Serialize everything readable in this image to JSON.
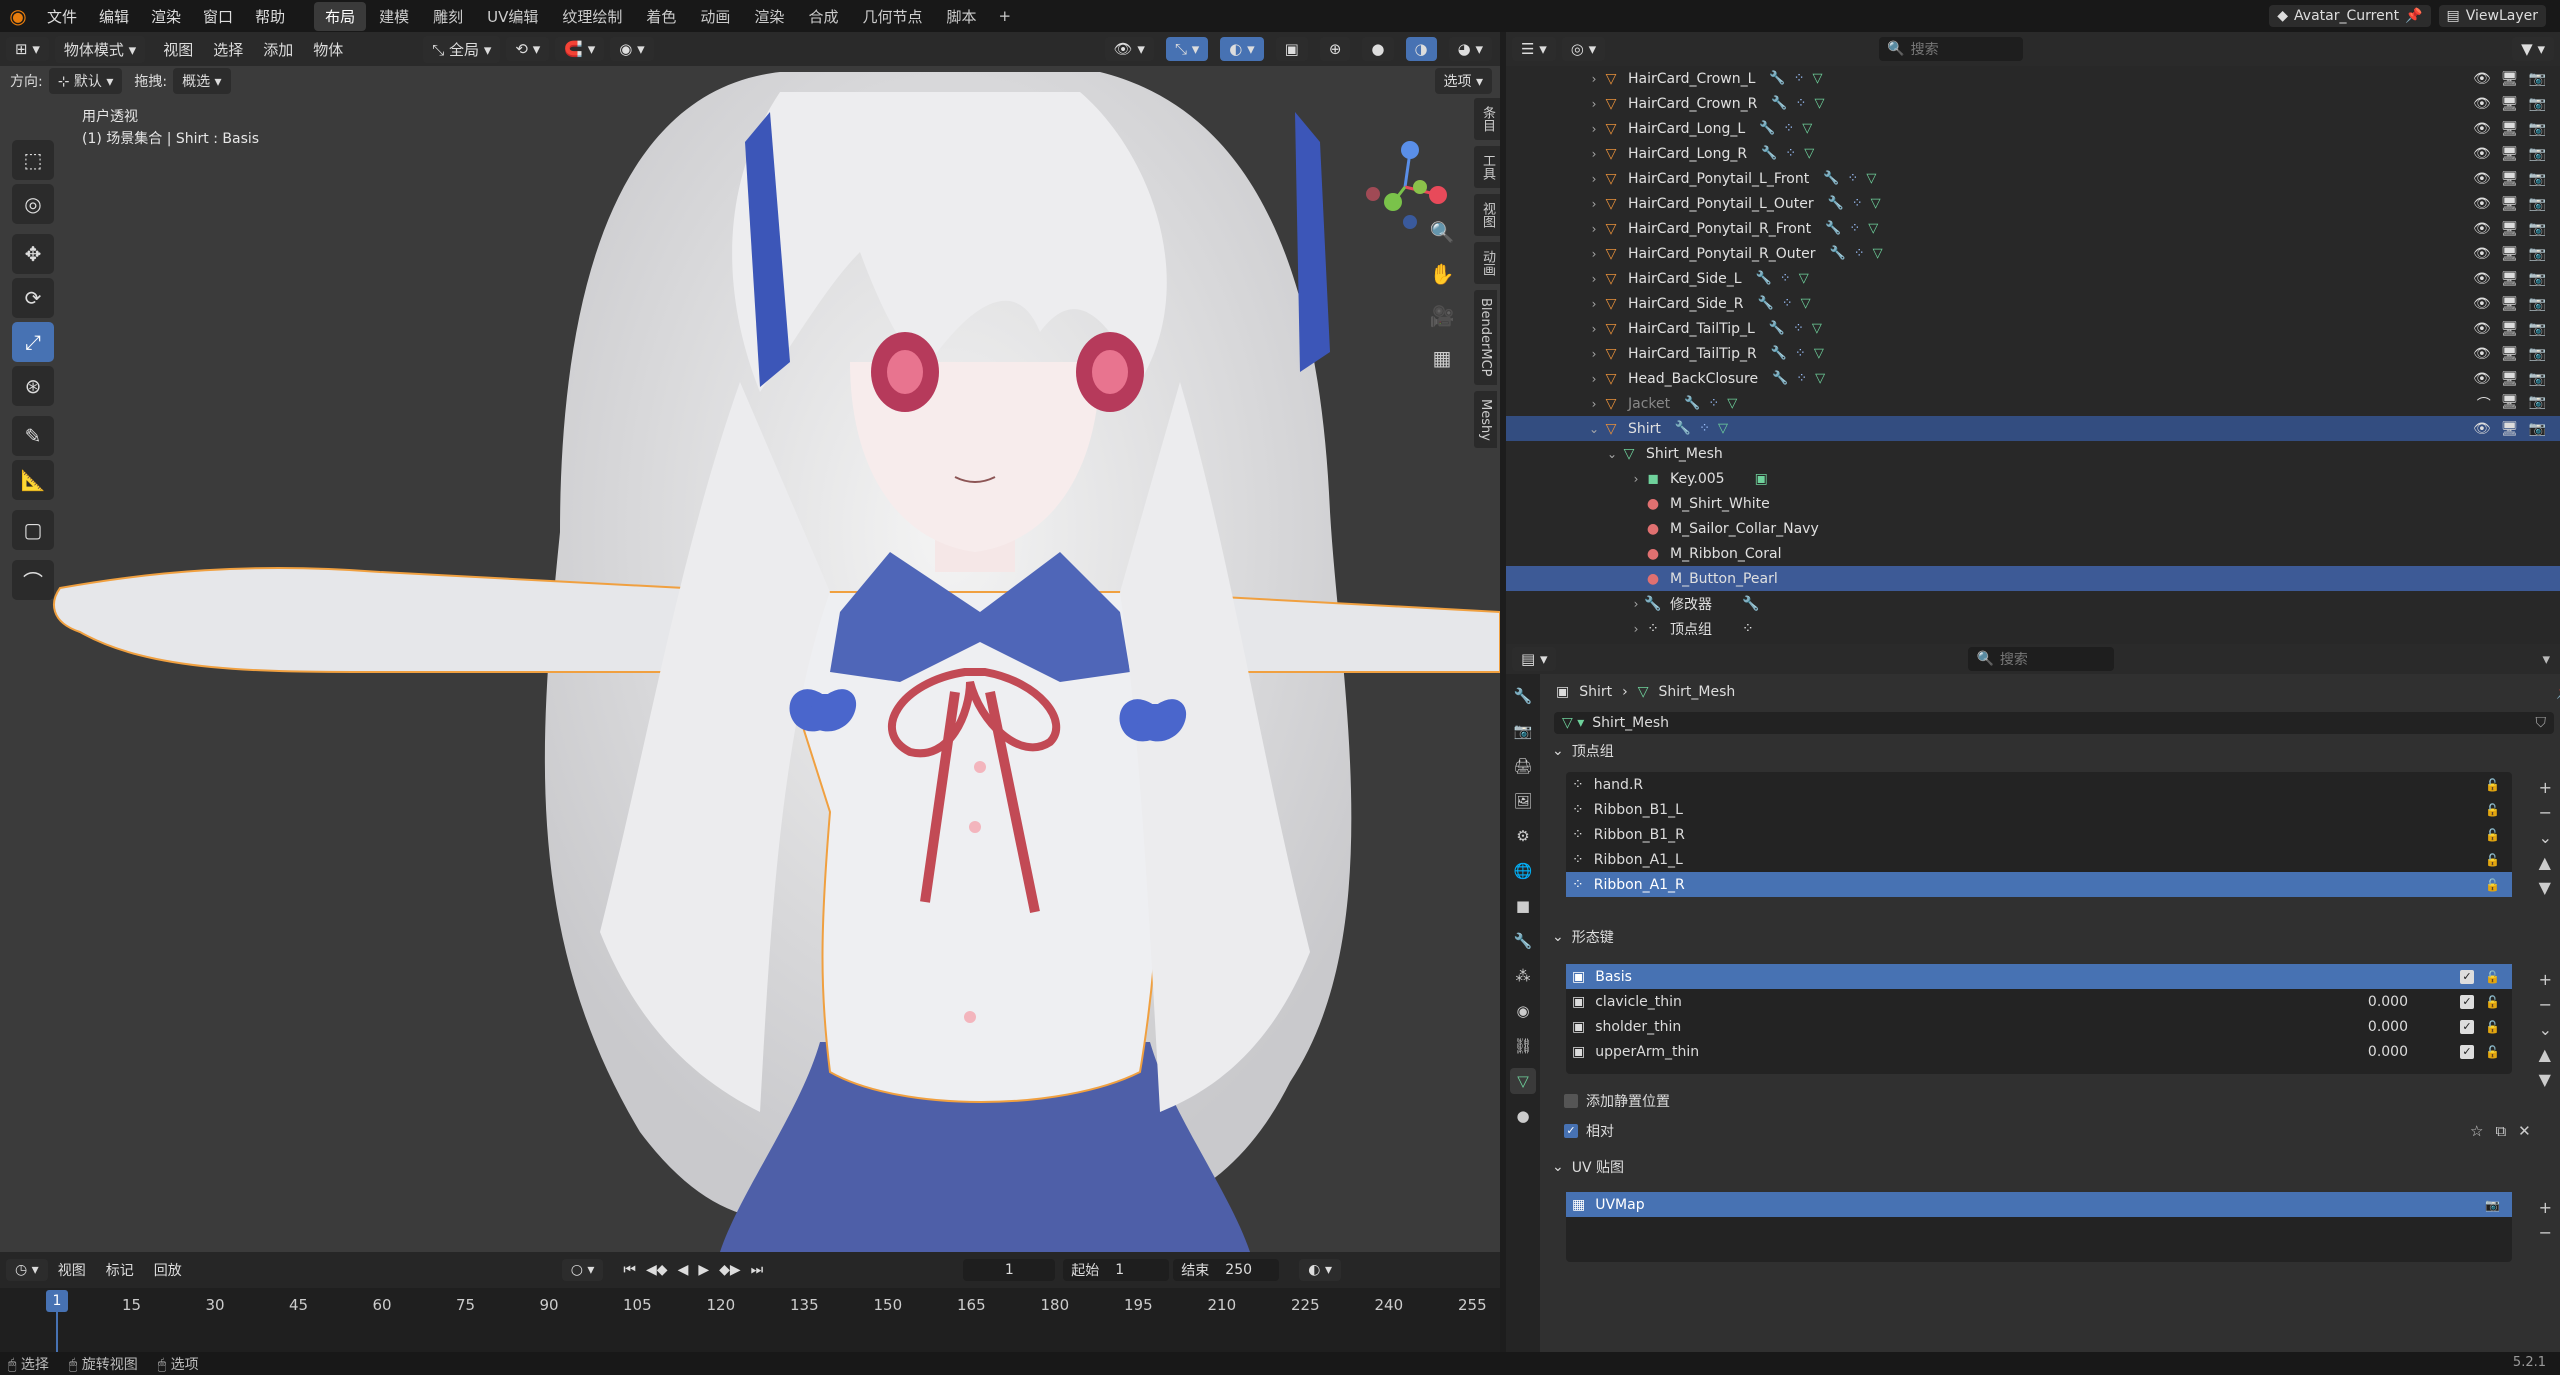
{
  "topbar": {
    "menus": [
      "文件",
      "编辑",
      "渲染",
      "窗口",
      "帮助"
    ],
    "workspaces": [
      "布局",
      "建模",
      "雕刻",
      "UV编辑",
      "纹理绘制",
      "着色",
      "动画",
      "渲染",
      "合成",
      "几何节点",
      "脚本"
    ],
    "active_workspace": "布局",
    "scene": "Avatar_Current",
    "view_layer": "ViewLayer"
  },
  "viewport": {
    "mode": "物体模式",
    "menus": [
      "视图",
      "选择",
      "添加",
      "物体"
    ],
    "orientation_label": "方向:",
    "orientation_value": "默认",
    "drag_label": "拖拽:",
    "drag_value": "概选",
    "transform_global": "全局",
    "options": "选项",
    "info_line1": "用户透视",
    "info_line2": "(1) 场景集合 | Shirt : Basis",
    "side_tabs": [
      "条目",
      "工具",
      "视图",
      "动画",
      "BlenderMCP",
      "Meshy"
    ]
  },
  "timeline": {
    "menus": [
      "视图",
      "标记",
      "回放"
    ],
    "current_frame": "1",
    "start_label": "起始",
    "start": "1",
    "end_label": "结束",
    "end": "250",
    "ticks": [
      "1",
      "15",
      "30",
      "45",
      "60",
      "75",
      "90",
      "105",
      "120",
      "135",
      "150",
      "165",
      "180",
      "195",
      "210",
      "225",
      "240",
      "255"
    ]
  },
  "status": {
    "items": [
      "选择",
      "旋转视图",
      "选项"
    ],
    "version": "5.2.1"
  },
  "outliner": {
    "search_placeholder": "搜索",
    "rows": [
      {
        "label": "HairCard_Crown_L",
        "type": "object"
      },
      {
        "label": "HairCard_Crown_R",
        "type": "object"
      },
      {
        "label": "HairCard_Long_L",
        "type": "object"
      },
      {
        "label": "HairCard_Long_R",
        "type": "object"
      },
      {
        "label": "HairCard_Ponytail_L_Front",
        "type": "object"
      },
      {
        "label": "HairCard_Ponytail_L_Outer",
        "type": "object"
      },
      {
        "label": "HairCard_Ponytail_R_Front",
        "type": "object"
      },
      {
        "label": "HairCard_Ponytail_R_Outer",
        "type": "object"
      },
      {
        "label": "HairCard_Side_L",
        "type": "object"
      },
      {
        "label": "HairCard_Side_R",
        "type": "object"
      },
      {
        "label": "HairCard_TailTip_L",
        "type": "object"
      },
      {
        "label": "HairCard_TailTip_R",
        "type": "object"
      },
      {
        "label": "Head_BackClosure",
        "type": "object"
      },
      {
        "label": "Jacket",
        "type": "object"
      },
      {
        "label": "Shirt",
        "type": "object"
      },
      {
        "label": "Shirt_Mesh",
        "type": "mesh"
      },
      {
        "label": "Key.005",
        "type": "key"
      },
      {
        "label": "M_Shirt_White",
        "type": "material"
      },
      {
        "label": "M_Sailor_Collar_Navy",
        "type": "material"
      },
      {
        "label": "M_Ribbon_Coral",
        "type": "material"
      },
      {
        "label": "M_Button_Pearl",
        "type": "material"
      },
      {
        "label": "修改器",
        "type": "modifier"
      },
      {
        "label": "顶点组",
        "type": "vgroup"
      }
    ]
  },
  "properties": {
    "search_placeholder": "搜索",
    "breadcrumb_object": "Shirt",
    "breadcrumb_mesh": "Shirt_Mesh",
    "mesh_name": "Shirt_Mesh",
    "vertex_groups_title": "顶点组",
    "vertex_groups": [
      "hand.R",
      "Ribbon_B1_L",
      "Ribbon_B1_R",
      "Ribbon_A1_L",
      "Ribbon_A1_R"
    ],
    "shape_keys_title": "形态键",
    "shape_keys": [
      {
        "name": "Basis",
        "value": ""
      },
      {
        "name": "clavicle_thin",
        "value": "0.000"
      },
      {
        "name": "sholder_thin",
        "value": "0.000"
      },
      {
        "name": "upperArm_thin",
        "value": "0.000"
      }
    ],
    "add_rest_position": "添加静置位置",
    "relative": "相对",
    "uv_maps_title": "UV 贴图",
    "uv_maps": [
      "UVMap"
    ]
  }
}
